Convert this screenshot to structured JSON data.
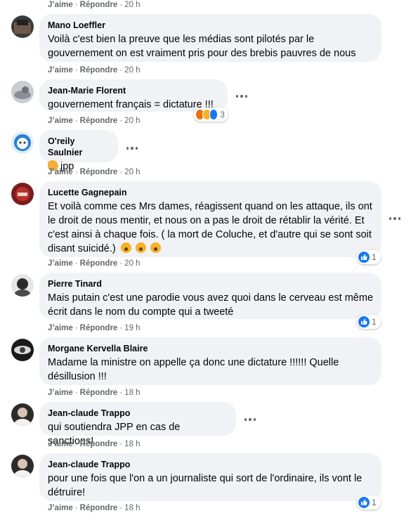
{
  "actions": {
    "like": "J’aime",
    "reply": "Répondre",
    "dot": "·"
  },
  "top_timestamp": "20 h",
  "comments": [
    {
      "author": "Mano Loeffler",
      "text": "Voilà c'est bien la preuve que les médias sont pilotés par le gouvernement on est vraiment pris pour des brebis pauvres de nous",
      "time": "20 h"
    },
    {
      "author": "Jean-Marie Florent",
      "text": "gouvernement français = dictature !!!",
      "time": "20 h",
      "reaction_count": "3"
    },
    {
      "author": "O'reily Saulnier",
      "text": "jpp",
      "time": "20 h"
    },
    {
      "author": "Lucette Gagnepain",
      "text": "Et voilà comme ces Mrs dames, réagissent quand on les attaque, ils ont le droit de nous mentir, et nous on a pas le droit de rétablir la vérité. Et c'est ainsi à chaque fois. ( la mort de Coluche, et d'autre qui se sont soit disant suicidé.)",
      "time": "20 h",
      "reaction_count": "1"
    },
    {
      "author": "Pierre Tinard",
      "text": "Mais putain c'est une parodie vous avez quoi dans le cerveau est même écrit dans le nom du compte qui a tweeté",
      "time": "19 h",
      "reaction_count": "1"
    },
    {
      "author": "Morgane Kervella Blaire",
      "text": "Madame la ministre on appelle ça donc une dictature !!!!!! Quelle désillusion !!!",
      "time": "18 h"
    },
    {
      "author": "Jean-claude Trappo",
      "text": "qui soutiendra JPP en cas de sanctions!",
      "time": "18 h"
    },
    {
      "author": "Jean-claude Trappo",
      "text": "pour une fois que l'on a un journaliste qui sort de l'ordinaire, ils vont le détruire!",
      "time": "18 h",
      "reaction_count": "1"
    }
  ],
  "colors": {
    "bubble": "#f0f2f5",
    "meta": "#65676b",
    "like_blue": "#1877f2",
    "text": "#050505"
  },
  "icons": {
    "like": "thumbs-up-icon",
    "haha": "haha-emoji-icon",
    "angry": "angry-emoji-icon",
    "scream": "scream-emoji-icon",
    "clap": "clap-emoji-icon",
    "more": "more-dots-icon"
  }
}
